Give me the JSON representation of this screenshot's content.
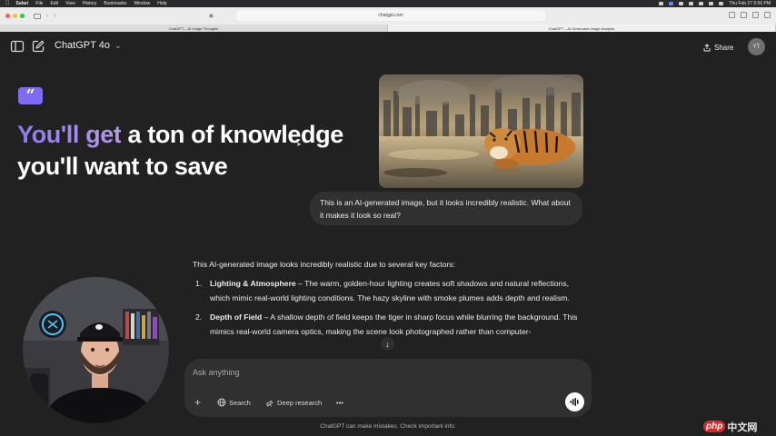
{
  "menubar": {
    "app": "Safari",
    "items": [
      "File",
      "Edit",
      "View",
      "History",
      "Bookmarks",
      "Window",
      "Help"
    ],
    "clock": "Thu Feb 27  6:56 PM"
  },
  "browser": {
    "url": "chatgpt.com",
    "tabs": [
      "ChatGPT – AI Image Thoughts",
      "ChatGPT – AI-Generated Image Analysis"
    ]
  },
  "header": {
    "model": "ChatGPT 4o",
    "share_label": "Share",
    "avatar_initials": "YT"
  },
  "promo": {
    "accent_text": "You'll get",
    "rest_text": " a ton of knowledge you'll want to save",
    "badge_glyph": "“"
  },
  "conversation": {
    "user_message": "This is an AI-generated image, but it looks incredibly realistic. What about it makes it look so real?",
    "assistant": {
      "intro": "This AI-generated image looks incredibly realistic due to several key factors:",
      "points": [
        {
          "num": "1.",
          "title": "Lighting & Atmosphere",
          "text": " – The warm, golden-hour lighting creates soft shadows and natural reflections, which mimic real-world lighting conditions. The hazy skyline with smoke plumes adds depth and realism."
        },
        {
          "num": "2.",
          "title": "Depth of Field",
          "text": " – A shallow depth of field keeps the tiger in sharp focus while blurring the background. This mimics real-world camera optics, making the scene look photographed rather than computer-"
        }
      ]
    }
  },
  "composer": {
    "placeholder": "Ask anything",
    "search_label": "Search",
    "deep_research_label": "Deep research",
    "more_label": "•••"
  },
  "footer": {
    "disclaimer": "ChatGPT can make mistakes. Check important info."
  },
  "colors": {
    "background": "#212121",
    "bubble": "#303030",
    "accent": "#7d6cf0"
  },
  "watermark": {
    "logo": "php",
    "text": "中文网"
  }
}
